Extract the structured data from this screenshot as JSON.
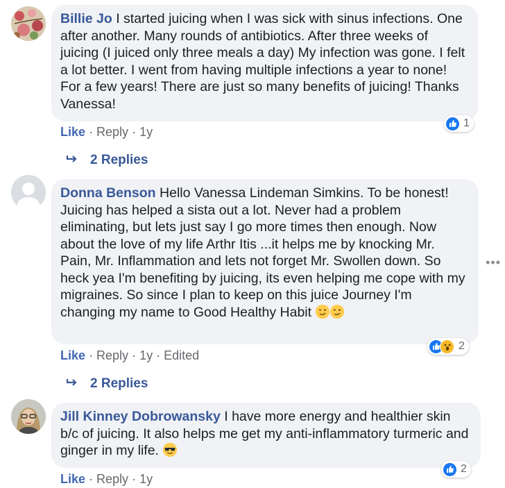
{
  "comments": [
    {
      "author": "Billie Jo",
      "text": "I started juicing when I was sick with sinus infections. One after another. Many rounds of antibiotics. After three weeks of juicing (I juiced only three meals a day) My infection was gone. I felt a lot better. I went from having multiple infections a year to none! For a few years! There are just so many benefits of juicing! Thanks Vanessa!",
      "like_label": "Like",
      "reply_label": "Reply",
      "time": "1y",
      "reaction_count": "1",
      "replies_label": "2 Replies"
    },
    {
      "author": "Donna Benson",
      "text": "Hello Vanessa Lindeman Simkins. To be honest! Juicing has helped a sista out a lot. Never had a problem eliminating, but lets just say I go more times then enough. Now about the love of my life Arthr Itis ...it helps me by knocking Mr. Pain, Mr. Inflammation and lets not forget Mr. Swollen down. So heck yea I'm benefiting by juicing, its even helping me cope with my migraines. So since I plan to keep on this juice Journey I'm changing my name to Good Healthy Habit",
      "like_label": "Like",
      "reply_label": "Reply",
      "time": "1y",
      "edited_label": "Edited",
      "reaction_count": "2",
      "replies_label": "2 Replies"
    },
    {
      "author": "Jill Kinney Dobrowansky",
      "text": "I have more energy and healthier skin b/c of juicing. It also helps me get my anti-inflammatory turmeric and ginger in my life.",
      "like_label": "Like",
      "reply_label": "Reply",
      "time": "1y",
      "reaction_count": "2"
    }
  ],
  "more_options": "•••",
  "colors": {
    "author_link": "#385898",
    "like_blue": "#4267b2",
    "bubble_bg": "#f0f2f5",
    "meta_gray": "#65676b"
  },
  "icons": {
    "reply_arrow": "reply-arrow-icon",
    "like_reaction": "thumbs-up-icon",
    "wow_reaction": "wow-face-icon",
    "wink_emoji": "winking-face-emoji",
    "sunglasses_emoji": "sunglasses-face-emoji"
  }
}
